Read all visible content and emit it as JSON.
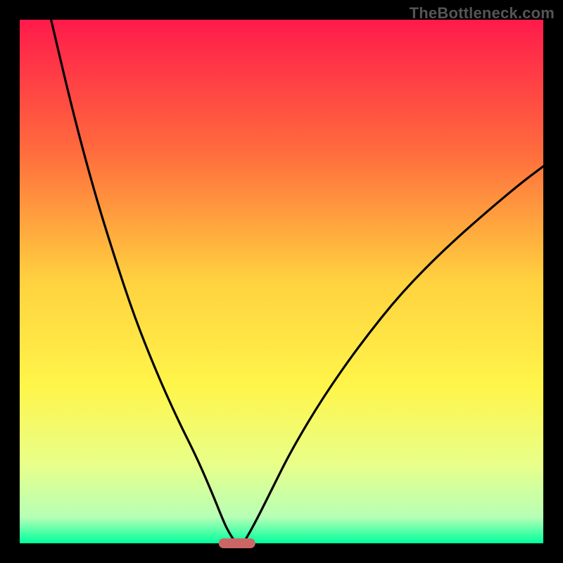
{
  "watermark": "TheBottleneck.com",
  "chart_data": {
    "type": "line",
    "title": "",
    "xlabel": "",
    "ylabel": "",
    "xlim": [
      0,
      100
    ],
    "ylim": [
      0,
      100
    ],
    "grid": false,
    "legend": false,
    "background_gradient": {
      "stops": [
        {
          "offset": 0.0,
          "color": "#ff1a4b"
        },
        {
          "offset": 0.25,
          "color": "#ff6b3d"
        },
        {
          "offset": 0.5,
          "color": "#ffd23f"
        },
        {
          "offset": 0.7,
          "color": "#fff54a"
        },
        {
          "offset": 0.85,
          "color": "#e8ff8a"
        },
        {
          "offset": 0.95,
          "color": "#b6ffb6"
        },
        {
          "offset": 1.0,
          "color": "#00ff9c"
        }
      ]
    },
    "optimal_zone": {
      "x_start": 38,
      "x_end": 45,
      "y": 0,
      "color": "#cc6666"
    },
    "series": [
      {
        "name": "left_curve",
        "x": [
          6,
          10,
          14,
          18,
          22,
          26,
          30,
          34,
          37,
          39,
          40,
          41
        ],
        "y": [
          100,
          83,
          68,
          55,
          43,
          33,
          24,
          16,
          9,
          4,
          2,
          0.5
        ]
      },
      {
        "name": "right_curve",
        "x": [
          43,
          45,
          48,
          52,
          58,
          65,
          73,
          82,
          90,
          96,
          100
        ],
        "y": [
          0.5,
          4,
          10,
          18,
          28,
          38,
          48,
          57,
          64,
          69,
          72
        ]
      }
    ]
  }
}
